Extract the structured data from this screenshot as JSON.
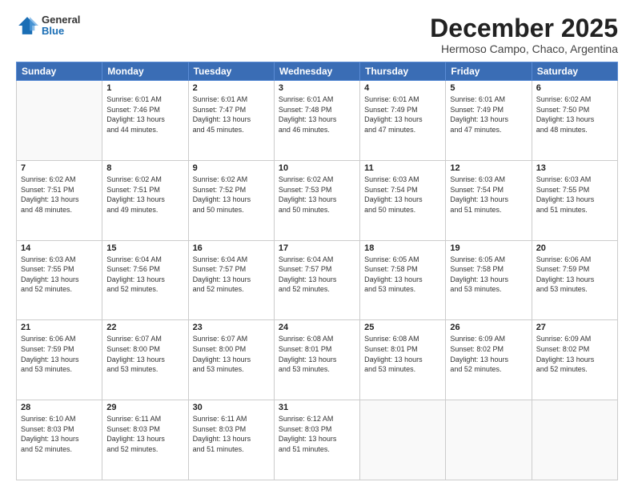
{
  "header": {
    "logo_general": "General",
    "logo_blue": "Blue",
    "month_title": "December 2025",
    "location": "Hermoso Campo, Chaco, Argentina"
  },
  "days_of_week": [
    "Sunday",
    "Monday",
    "Tuesday",
    "Wednesday",
    "Thursday",
    "Friday",
    "Saturday"
  ],
  "weeks": [
    [
      {
        "day": "",
        "sunrise": "",
        "sunset": "",
        "daylight": ""
      },
      {
        "day": "1",
        "sunrise": "Sunrise: 6:01 AM",
        "sunset": "Sunset: 7:46 PM",
        "daylight": "Daylight: 13 hours and 44 minutes."
      },
      {
        "day": "2",
        "sunrise": "Sunrise: 6:01 AM",
        "sunset": "Sunset: 7:47 PM",
        "daylight": "Daylight: 13 hours and 45 minutes."
      },
      {
        "day": "3",
        "sunrise": "Sunrise: 6:01 AM",
        "sunset": "Sunset: 7:48 PM",
        "daylight": "Daylight: 13 hours and 46 minutes."
      },
      {
        "day": "4",
        "sunrise": "Sunrise: 6:01 AM",
        "sunset": "Sunset: 7:49 PM",
        "daylight": "Daylight: 13 hours and 47 minutes."
      },
      {
        "day": "5",
        "sunrise": "Sunrise: 6:01 AM",
        "sunset": "Sunset: 7:49 PM",
        "daylight": "Daylight: 13 hours and 47 minutes."
      },
      {
        "day": "6",
        "sunrise": "Sunrise: 6:02 AM",
        "sunset": "Sunset: 7:50 PM",
        "daylight": "Daylight: 13 hours and 48 minutes."
      }
    ],
    [
      {
        "day": "7",
        "sunrise": "Sunrise: 6:02 AM",
        "sunset": "Sunset: 7:51 PM",
        "daylight": "Daylight: 13 hours and 48 minutes."
      },
      {
        "day": "8",
        "sunrise": "Sunrise: 6:02 AM",
        "sunset": "Sunset: 7:51 PM",
        "daylight": "Daylight: 13 hours and 49 minutes."
      },
      {
        "day": "9",
        "sunrise": "Sunrise: 6:02 AM",
        "sunset": "Sunset: 7:52 PM",
        "daylight": "Daylight: 13 hours and 50 minutes."
      },
      {
        "day": "10",
        "sunrise": "Sunrise: 6:02 AM",
        "sunset": "Sunset: 7:53 PM",
        "daylight": "Daylight: 13 hours and 50 minutes."
      },
      {
        "day": "11",
        "sunrise": "Sunrise: 6:03 AM",
        "sunset": "Sunset: 7:54 PM",
        "daylight": "Daylight: 13 hours and 50 minutes."
      },
      {
        "day": "12",
        "sunrise": "Sunrise: 6:03 AM",
        "sunset": "Sunset: 7:54 PM",
        "daylight": "Daylight: 13 hours and 51 minutes."
      },
      {
        "day": "13",
        "sunrise": "Sunrise: 6:03 AM",
        "sunset": "Sunset: 7:55 PM",
        "daylight": "Daylight: 13 hours and 51 minutes."
      }
    ],
    [
      {
        "day": "14",
        "sunrise": "Sunrise: 6:03 AM",
        "sunset": "Sunset: 7:55 PM",
        "daylight": "Daylight: 13 hours and 52 minutes."
      },
      {
        "day": "15",
        "sunrise": "Sunrise: 6:04 AM",
        "sunset": "Sunset: 7:56 PM",
        "daylight": "Daylight: 13 hours and 52 minutes."
      },
      {
        "day": "16",
        "sunrise": "Sunrise: 6:04 AM",
        "sunset": "Sunset: 7:57 PM",
        "daylight": "Daylight: 13 hours and 52 minutes."
      },
      {
        "day": "17",
        "sunrise": "Sunrise: 6:04 AM",
        "sunset": "Sunset: 7:57 PM",
        "daylight": "Daylight: 13 hours and 52 minutes."
      },
      {
        "day": "18",
        "sunrise": "Sunrise: 6:05 AM",
        "sunset": "Sunset: 7:58 PM",
        "daylight": "Daylight: 13 hours and 53 minutes."
      },
      {
        "day": "19",
        "sunrise": "Sunrise: 6:05 AM",
        "sunset": "Sunset: 7:58 PM",
        "daylight": "Daylight: 13 hours and 53 minutes."
      },
      {
        "day": "20",
        "sunrise": "Sunrise: 6:06 AM",
        "sunset": "Sunset: 7:59 PM",
        "daylight": "Daylight: 13 hours and 53 minutes."
      }
    ],
    [
      {
        "day": "21",
        "sunrise": "Sunrise: 6:06 AM",
        "sunset": "Sunset: 7:59 PM",
        "daylight": "Daylight: 13 hours and 53 minutes."
      },
      {
        "day": "22",
        "sunrise": "Sunrise: 6:07 AM",
        "sunset": "Sunset: 8:00 PM",
        "daylight": "Daylight: 13 hours and 53 minutes."
      },
      {
        "day": "23",
        "sunrise": "Sunrise: 6:07 AM",
        "sunset": "Sunset: 8:00 PM",
        "daylight": "Daylight: 13 hours and 53 minutes."
      },
      {
        "day": "24",
        "sunrise": "Sunrise: 6:08 AM",
        "sunset": "Sunset: 8:01 PM",
        "daylight": "Daylight: 13 hours and 53 minutes."
      },
      {
        "day": "25",
        "sunrise": "Sunrise: 6:08 AM",
        "sunset": "Sunset: 8:01 PM",
        "daylight": "Daylight: 13 hours and 53 minutes."
      },
      {
        "day": "26",
        "sunrise": "Sunrise: 6:09 AM",
        "sunset": "Sunset: 8:02 PM",
        "daylight": "Daylight: 13 hours and 52 minutes."
      },
      {
        "day": "27",
        "sunrise": "Sunrise: 6:09 AM",
        "sunset": "Sunset: 8:02 PM",
        "daylight": "Daylight: 13 hours and 52 minutes."
      }
    ],
    [
      {
        "day": "28",
        "sunrise": "Sunrise: 6:10 AM",
        "sunset": "Sunset: 8:03 PM",
        "daylight": "Daylight: 13 hours and 52 minutes."
      },
      {
        "day": "29",
        "sunrise": "Sunrise: 6:11 AM",
        "sunset": "Sunset: 8:03 PM",
        "daylight": "Daylight: 13 hours and 52 minutes."
      },
      {
        "day": "30",
        "sunrise": "Sunrise: 6:11 AM",
        "sunset": "Sunset: 8:03 PM",
        "daylight": "Daylight: 13 hours and 51 minutes."
      },
      {
        "day": "31",
        "sunrise": "Sunrise: 6:12 AM",
        "sunset": "Sunset: 8:03 PM",
        "daylight": "Daylight: 13 hours and 51 minutes."
      },
      {
        "day": "",
        "sunrise": "",
        "sunset": "",
        "daylight": ""
      },
      {
        "day": "",
        "sunrise": "",
        "sunset": "",
        "daylight": ""
      },
      {
        "day": "",
        "sunrise": "",
        "sunset": "",
        "daylight": ""
      }
    ]
  ]
}
